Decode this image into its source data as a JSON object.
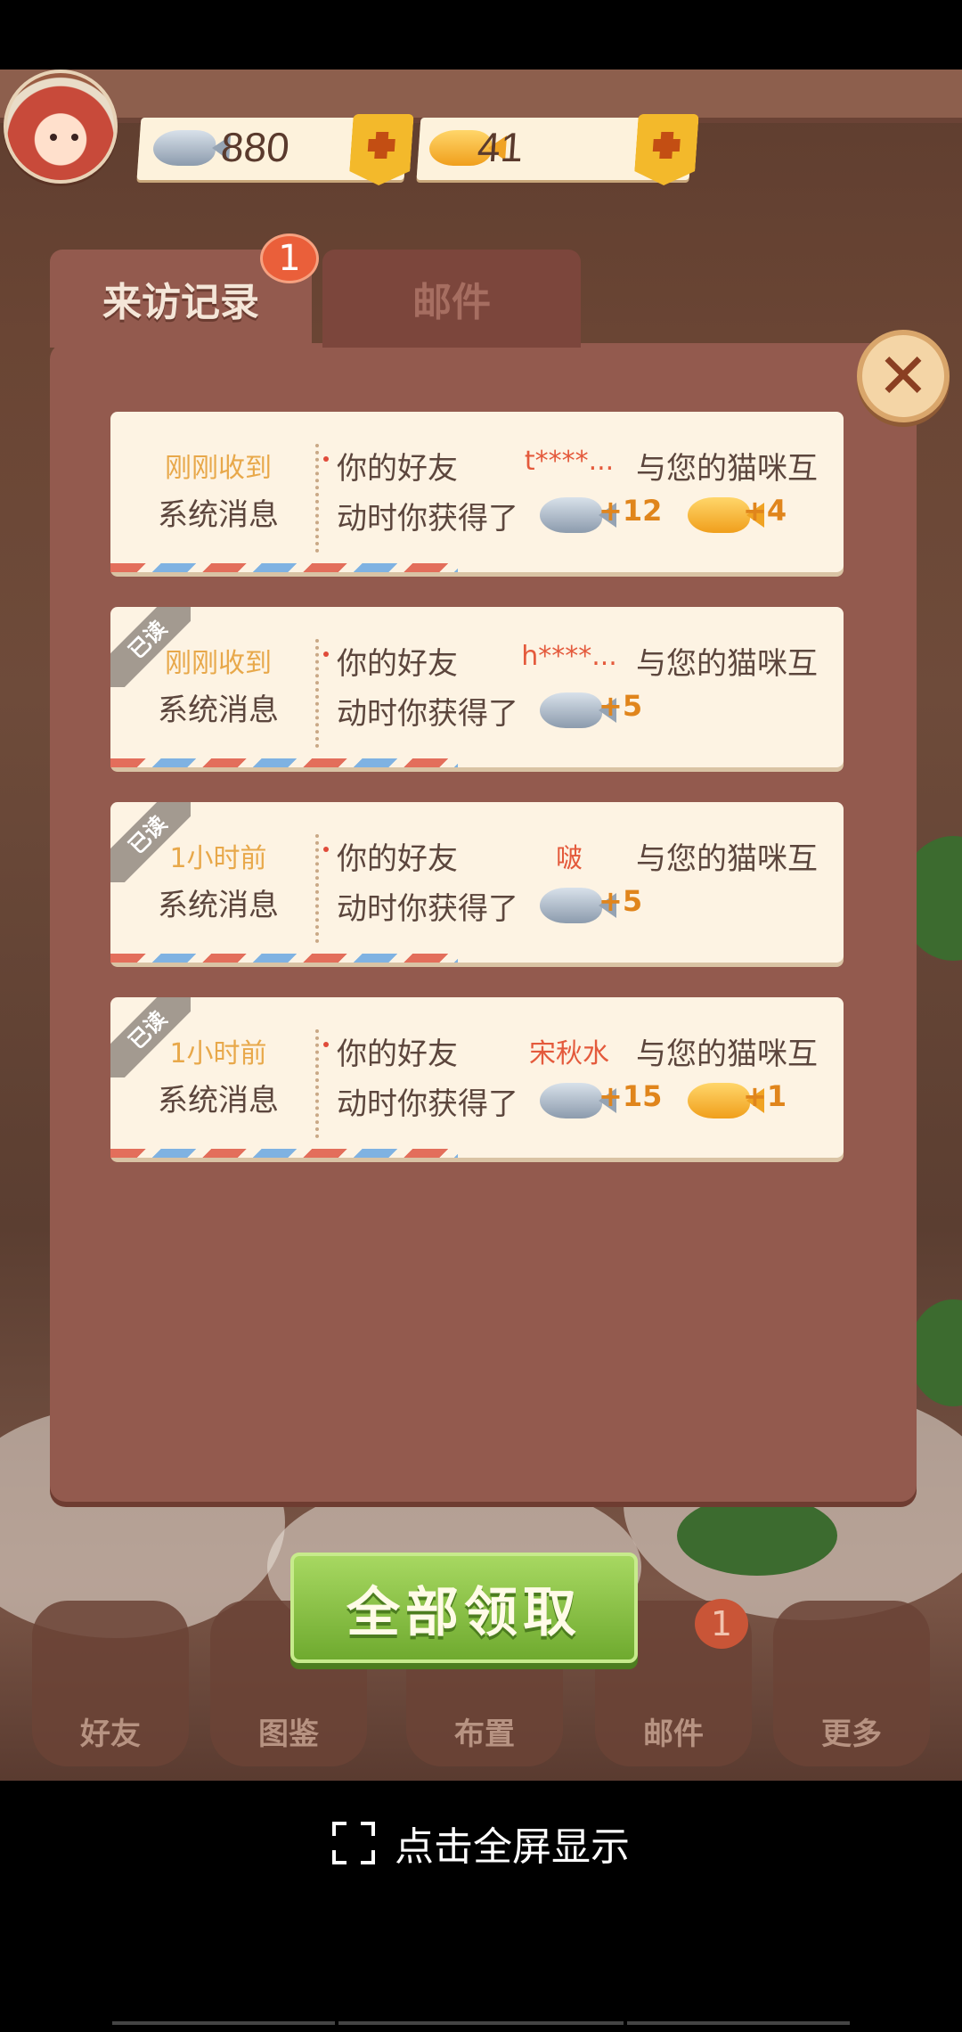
{
  "hud": {
    "silver_fish": "880",
    "gold_fish": "41"
  },
  "tabs": [
    {
      "label": "来访记录",
      "badge": "1"
    },
    {
      "label": "邮件"
    }
  ],
  "messages": [
    {
      "time": "刚刚收到",
      "type": "系统消息",
      "prefix": "你的好友",
      "friend": "t****...",
      "suffix": "与您的猫咪互",
      "line2": "动时你获得了",
      "silver": "+12",
      "gold": "+4",
      "read": false
    },
    {
      "time": "刚刚收到",
      "type": "系统消息",
      "prefix": "你的好友",
      "friend": "h****...",
      "suffix": "与您的猫咪互",
      "line2": "动时你获得了",
      "silver": "+5",
      "read": true
    },
    {
      "time": "1小时前",
      "type": "系统消息",
      "prefix": "你的好友",
      "friend": "啵",
      "suffix": "与您的猫咪互",
      "line2": "动时你获得了",
      "silver": "+5",
      "read": true
    },
    {
      "time": "1小时前",
      "type": "系统消息",
      "prefix": "你的好友",
      "friend": "宋秋水",
      "suffix": "与您的猫咪互",
      "line2": "动时你获得了",
      "silver": "+15",
      "gold": "+1",
      "read": true
    }
  ],
  "read_label": "已读",
  "claim_all": "全部领取",
  "bottom_nav": [
    {
      "label": "好友"
    },
    {
      "label": "图鉴"
    },
    {
      "label": "布置"
    },
    {
      "label": "邮件",
      "badge": "1"
    },
    {
      "label": "更多"
    }
  ],
  "fullscreen_label": "点击全屏显示",
  "colors": {
    "panel": "#935a4e",
    "card": "#fdf3e3",
    "accent_orange": "#e0851c",
    "friend_red": "#e45a3c",
    "claim_green": "#8cc44a"
  }
}
